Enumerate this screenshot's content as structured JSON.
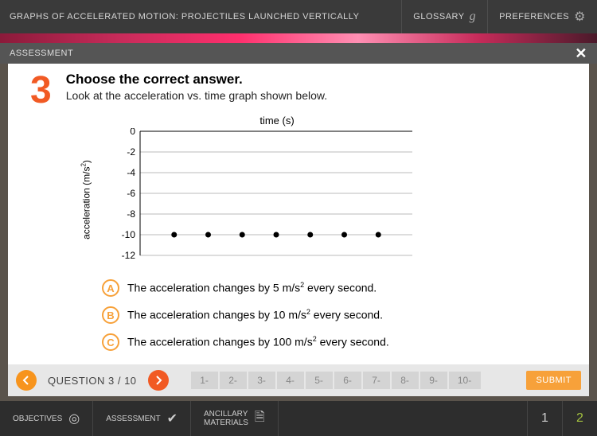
{
  "header": {
    "title": "GRAPHS OF ACCELERATED MOTION: PROJECTILES LAUNCHED VERTICALLY",
    "glossary": "GLOSSARY",
    "preferences": "PREFERENCES"
  },
  "assessment_bar": {
    "label": "ASSESSMENT"
  },
  "question": {
    "number": "3",
    "prompt_title": "Choose the correct answer.",
    "prompt_sub": "Look at the acceleration vs. time graph shown below."
  },
  "chart_data": {
    "type": "scatter",
    "title": "time (s)",
    "xlabel": "time (s)",
    "ylabel": "acceleration (m/s²)",
    "xlim": [
      0,
      8
    ],
    "ylim": [
      -12,
      0
    ],
    "x_ticks": [
      1,
      2,
      3,
      4,
      5,
      6,
      7,
      8
    ],
    "y_ticks": [
      0,
      -2,
      -4,
      -6,
      -8,
      -10,
      -12
    ],
    "x": [
      1,
      2,
      3,
      4,
      5,
      6,
      7
    ],
    "y": [
      -10,
      -10,
      -10,
      -10,
      -10,
      -10,
      -10
    ]
  },
  "answers": [
    {
      "letter": "A",
      "text_pre": "The acceleration changes by 5 m/s",
      "sup": "2",
      "text_post": " every second."
    },
    {
      "letter": "B",
      "text_pre": "The acceleration changes by 10 m/s",
      "sup": "2",
      "text_post": " every second."
    },
    {
      "letter": "C",
      "text_pre": "The acceleration changes by 100 m/s",
      "sup": "2",
      "text_post": " every second."
    }
  ],
  "nav": {
    "label": "QUESTION 3 / 10",
    "tabs": [
      "1-",
      "2-",
      "3-",
      "4-",
      "5-",
      "6-",
      "7-",
      "8-",
      "9-",
      "10-"
    ],
    "submit": "SUBMIT"
  },
  "bottom": {
    "objectives": "OBJECTIVES",
    "assessment": "ASSESSMENT",
    "ancillary_l1": "ANCILLARY",
    "ancillary_l2": "MATERIALS",
    "pages": [
      "1",
      "2"
    ],
    "active_page": 2
  }
}
